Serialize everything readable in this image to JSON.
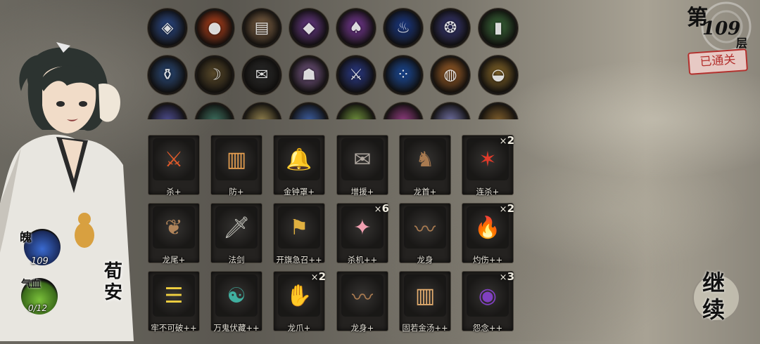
{
  "floor": {
    "prefix": "第",
    "number": "109",
    "suffix": "层",
    "status": "已通关"
  },
  "hero": {
    "name": "荀安",
    "soul_label": "魄",
    "soul_value": "109",
    "health_label": "气血",
    "health_value": "0/12"
  },
  "relics": {
    "rows": [
      [
        {
          "name": "coin-relic-icon",
          "glyph": "◈",
          "bg": "#2b4a8a"
        },
        {
          "name": "fire-orb-relic-icon",
          "glyph": "●",
          "bg": "#c0441c"
        },
        {
          "name": "scroll-relic-icon",
          "glyph": "▤",
          "bg": "#8a6a4a"
        },
        {
          "name": "crystal-relic-icon",
          "glyph": "◆",
          "bg": "#6a3a8a"
        },
        {
          "name": "mushroom-relic-icon",
          "glyph": "♠",
          "bg": "#7a3a9a"
        },
        {
          "name": "blue-flame-relic-icon",
          "glyph": "♨",
          "bg": "#1a3a8a"
        },
        {
          "name": "beads-relic-icon",
          "glyph": "❂",
          "bg": "#3a3a7a"
        },
        {
          "name": "tablet-relic-icon",
          "glyph": "▮",
          "bg": "#3a6a3a"
        }
      ],
      [
        {
          "name": "vase-relic-icon",
          "glyph": "⚱",
          "bg": "#2a4a7a"
        },
        {
          "name": "horn-relic-icon",
          "glyph": "☽",
          "bg": "#5a4a2a"
        },
        {
          "name": "talisman-relic-icon",
          "glyph": "✉",
          "bg": "#2a2a2a"
        },
        {
          "name": "beast-head-relic-icon",
          "glyph": "☗",
          "bg": "#7a5a8a"
        },
        {
          "name": "sword-relic-icon",
          "glyph": "⚔",
          "bg": "#2a3a8a"
        },
        {
          "name": "bracelet-relic-icon",
          "glyph": "⁘",
          "bg": "#1a4a9a"
        },
        {
          "name": "bread-relic-icon",
          "glyph": "◍",
          "bg": "#a8652a"
        },
        {
          "name": "bowl-relic-icon",
          "glyph": "◒",
          "bg": "#8a6a2a"
        }
      ],
      [
        {
          "name": "relic-row3-1-icon",
          "glyph": "",
          "bg": "#4a4a8a"
        },
        {
          "name": "relic-row3-2-icon",
          "glyph": "",
          "bg": "#3a6a5a"
        },
        {
          "name": "relic-row3-3-icon",
          "glyph": "",
          "bg": "#8a7a4a"
        },
        {
          "name": "relic-row3-4-icon",
          "glyph": "",
          "bg": "#3a5a9a"
        },
        {
          "name": "relic-row3-5-icon",
          "glyph": "",
          "bg": "#6a8a3a"
        },
        {
          "name": "relic-row3-6-icon",
          "glyph": "",
          "bg": "#8a3a7a"
        },
        {
          "name": "relic-row3-7-icon",
          "glyph": "",
          "bg": "#6a6a9a"
        },
        {
          "name": "relic-row3-8-icon",
          "glyph": "",
          "bg": "#7a5a2a"
        }
      ]
    ]
  },
  "cards": [
    [
      {
        "label": "杀+",
        "count": "",
        "glyph": "⚔",
        "color": "#e05a2a"
      },
      {
        "label": "防+",
        "count": "",
        "glyph": "▥",
        "color": "#e8a050"
      },
      {
        "label": "金钟罩+",
        "count": "",
        "glyph": "🔔",
        "color": "#c89a50"
      },
      {
        "label": "增援+",
        "count": "",
        "glyph": "✉",
        "color": "#b0a8a0"
      },
      {
        "label": "龙首+",
        "count": "",
        "glyph": "♞",
        "color": "#a87a50"
      },
      {
        "label": "连杀+",
        "count": "2",
        "glyph": "✶",
        "color": "#e03a2a"
      }
    ],
    [
      {
        "label": "龙尾+",
        "count": "",
        "glyph": "❦",
        "color": "#b0845a"
      },
      {
        "label": "法剑",
        "count": "",
        "glyph": "🗡",
        "color": "#c8c8c0"
      },
      {
        "label": "开旗急召++",
        "count": "",
        "glyph": "⚑",
        "color": "#e0b040"
      },
      {
        "label": "杀机++",
        "count": "6",
        "glyph": "✦",
        "color": "#f0a0b0"
      },
      {
        "label": "龙身",
        "count": "",
        "glyph": "〰",
        "color": "#a87a50"
      },
      {
        "label": "灼伤++",
        "count": "2",
        "glyph": "🔥",
        "color": "#d070e0"
      }
    ],
    [
      {
        "label": "牢不可破++",
        "count": "",
        "glyph": "☰",
        "color": "#f0d040"
      },
      {
        "label": "万鬼伏藏++",
        "count": "",
        "glyph": "☯",
        "color": "#40b0a0"
      },
      {
        "label": "龙爪+",
        "count": "2",
        "glyph": "✋",
        "color": "#a87a50"
      },
      {
        "label": "龙身+",
        "count": "",
        "glyph": "〰",
        "color": "#a87a50"
      },
      {
        "label": "固若金汤++",
        "count": "",
        "glyph": "▥",
        "color": "#e8b070"
      },
      {
        "label": "怨念++",
        "count": "3",
        "glyph": "◉",
        "color": "#8040c0"
      }
    ]
  ],
  "continue_button": {
    "label": "继续"
  }
}
